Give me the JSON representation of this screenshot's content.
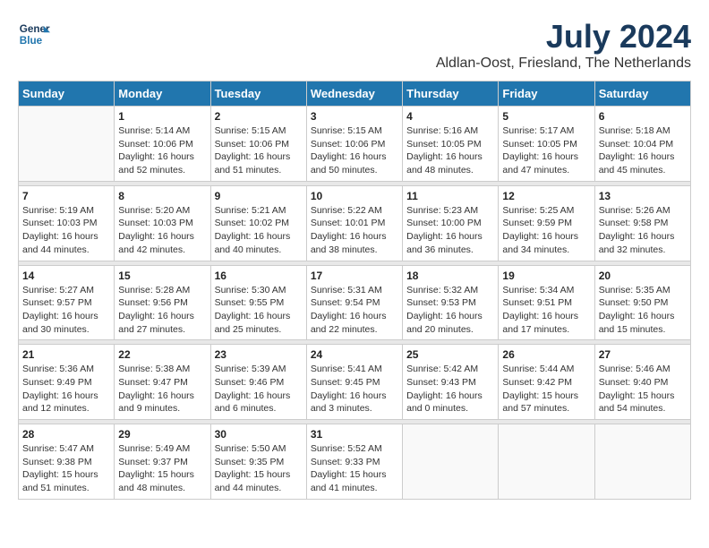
{
  "logo": {
    "line1": "General",
    "line2": "Blue"
  },
  "title": "July 2024",
  "location": "Aldlan-Oost, Friesland, The Netherlands",
  "weekdays": [
    "Sunday",
    "Monday",
    "Tuesday",
    "Wednesday",
    "Thursday",
    "Friday",
    "Saturday"
  ],
  "weeks": [
    [
      {
        "day": "",
        "info": ""
      },
      {
        "day": "1",
        "info": "Sunrise: 5:14 AM\nSunset: 10:06 PM\nDaylight: 16 hours\nand 52 minutes."
      },
      {
        "day": "2",
        "info": "Sunrise: 5:15 AM\nSunset: 10:06 PM\nDaylight: 16 hours\nand 51 minutes."
      },
      {
        "day": "3",
        "info": "Sunrise: 5:15 AM\nSunset: 10:06 PM\nDaylight: 16 hours\nand 50 minutes."
      },
      {
        "day": "4",
        "info": "Sunrise: 5:16 AM\nSunset: 10:05 PM\nDaylight: 16 hours\nand 48 minutes."
      },
      {
        "day": "5",
        "info": "Sunrise: 5:17 AM\nSunset: 10:05 PM\nDaylight: 16 hours\nand 47 minutes."
      },
      {
        "day": "6",
        "info": "Sunrise: 5:18 AM\nSunset: 10:04 PM\nDaylight: 16 hours\nand 45 minutes."
      }
    ],
    [
      {
        "day": "7",
        "info": "Sunrise: 5:19 AM\nSunset: 10:03 PM\nDaylight: 16 hours\nand 44 minutes."
      },
      {
        "day": "8",
        "info": "Sunrise: 5:20 AM\nSunset: 10:03 PM\nDaylight: 16 hours\nand 42 minutes."
      },
      {
        "day": "9",
        "info": "Sunrise: 5:21 AM\nSunset: 10:02 PM\nDaylight: 16 hours\nand 40 minutes."
      },
      {
        "day": "10",
        "info": "Sunrise: 5:22 AM\nSunset: 10:01 PM\nDaylight: 16 hours\nand 38 minutes."
      },
      {
        "day": "11",
        "info": "Sunrise: 5:23 AM\nSunset: 10:00 PM\nDaylight: 16 hours\nand 36 minutes."
      },
      {
        "day": "12",
        "info": "Sunrise: 5:25 AM\nSunset: 9:59 PM\nDaylight: 16 hours\nand 34 minutes."
      },
      {
        "day": "13",
        "info": "Sunrise: 5:26 AM\nSunset: 9:58 PM\nDaylight: 16 hours\nand 32 minutes."
      }
    ],
    [
      {
        "day": "14",
        "info": "Sunrise: 5:27 AM\nSunset: 9:57 PM\nDaylight: 16 hours\nand 30 minutes."
      },
      {
        "day": "15",
        "info": "Sunrise: 5:28 AM\nSunset: 9:56 PM\nDaylight: 16 hours\nand 27 minutes."
      },
      {
        "day": "16",
        "info": "Sunrise: 5:30 AM\nSunset: 9:55 PM\nDaylight: 16 hours\nand 25 minutes."
      },
      {
        "day": "17",
        "info": "Sunrise: 5:31 AM\nSunset: 9:54 PM\nDaylight: 16 hours\nand 22 minutes."
      },
      {
        "day": "18",
        "info": "Sunrise: 5:32 AM\nSunset: 9:53 PM\nDaylight: 16 hours\nand 20 minutes."
      },
      {
        "day": "19",
        "info": "Sunrise: 5:34 AM\nSunset: 9:51 PM\nDaylight: 16 hours\nand 17 minutes."
      },
      {
        "day": "20",
        "info": "Sunrise: 5:35 AM\nSunset: 9:50 PM\nDaylight: 16 hours\nand 15 minutes."
      }
    ],
    [
      {
        "day": "21",
        "info": "Sunrise: 5:36 AM\nSunset: 9:49 PM\nDaylight: 16 hours\nand 12 minutes."
      },
      {
        "day": "22",
        "info": "Sunrise: 5:38 AM\nSunset: 9:47 PM\nDaylight: 16 hours\nand 9 minutes."
      },
      {
        "day": "23",
        "info": "Sunrise: 5:39 AM\nSunset: 9:46 PM\nDaylight: 16 hours\nand 6 minutes."
      },
      {
        "day": "24",
        "info": "Sunrise: 5:41 AM\nSunset: 9:45 PM\nDaylight: 16 hours\nand 3 minutes."
      },
      {
        "day": "25",
        "info": "Sunrise: 5:42 AM\nSunset: 9:43 PM\nDaylight: 16 hours\nand 0 minutes."
      },
      {
        "day": "26",
        "info": "Sunrise: 5:44 AM\nSunset: 9:42 PM\nDaylight: 15 hours\nand 57 minutes."
      },
      {
        "day": "27",
        "info": "Sunrise: 5:46 AM\nSunset: 9:40 PM\nDaylight: 15 hours\nand 54 minutes."
      }
    ],
    [
      {
        "day": "28",
        "info": "Sunrise: 5:47 AM\nSunset: 9:38 PM\nDaylight: 15 hours\nand 51 minutes."
      },
      {
        "day": "29",
        "info": "Sunrise: 5:49 AM\nSunset: 9:37 PM\nDaylight: 15 hours\nand 48 minutes."
      },
      {
        "day": "30",
        "info": "Sunrise: 5:50 AM\nSunset: 9:35 PM\nDaylight: 15 hours\nand 44 minutes."
      },
      {
        "day": "31",
        "info": "Sunrise: 5:52 AM\nSunset: 9:33 PM\nDaylight: 15 hours\nand 41 minutes."
      },
      {
        "day": "",
        "info": ""
      },
      {
        "day": "",
        "info": ""
      },
      {
        "day": "",
        "info": ""
      }
    ]
  ]
}
